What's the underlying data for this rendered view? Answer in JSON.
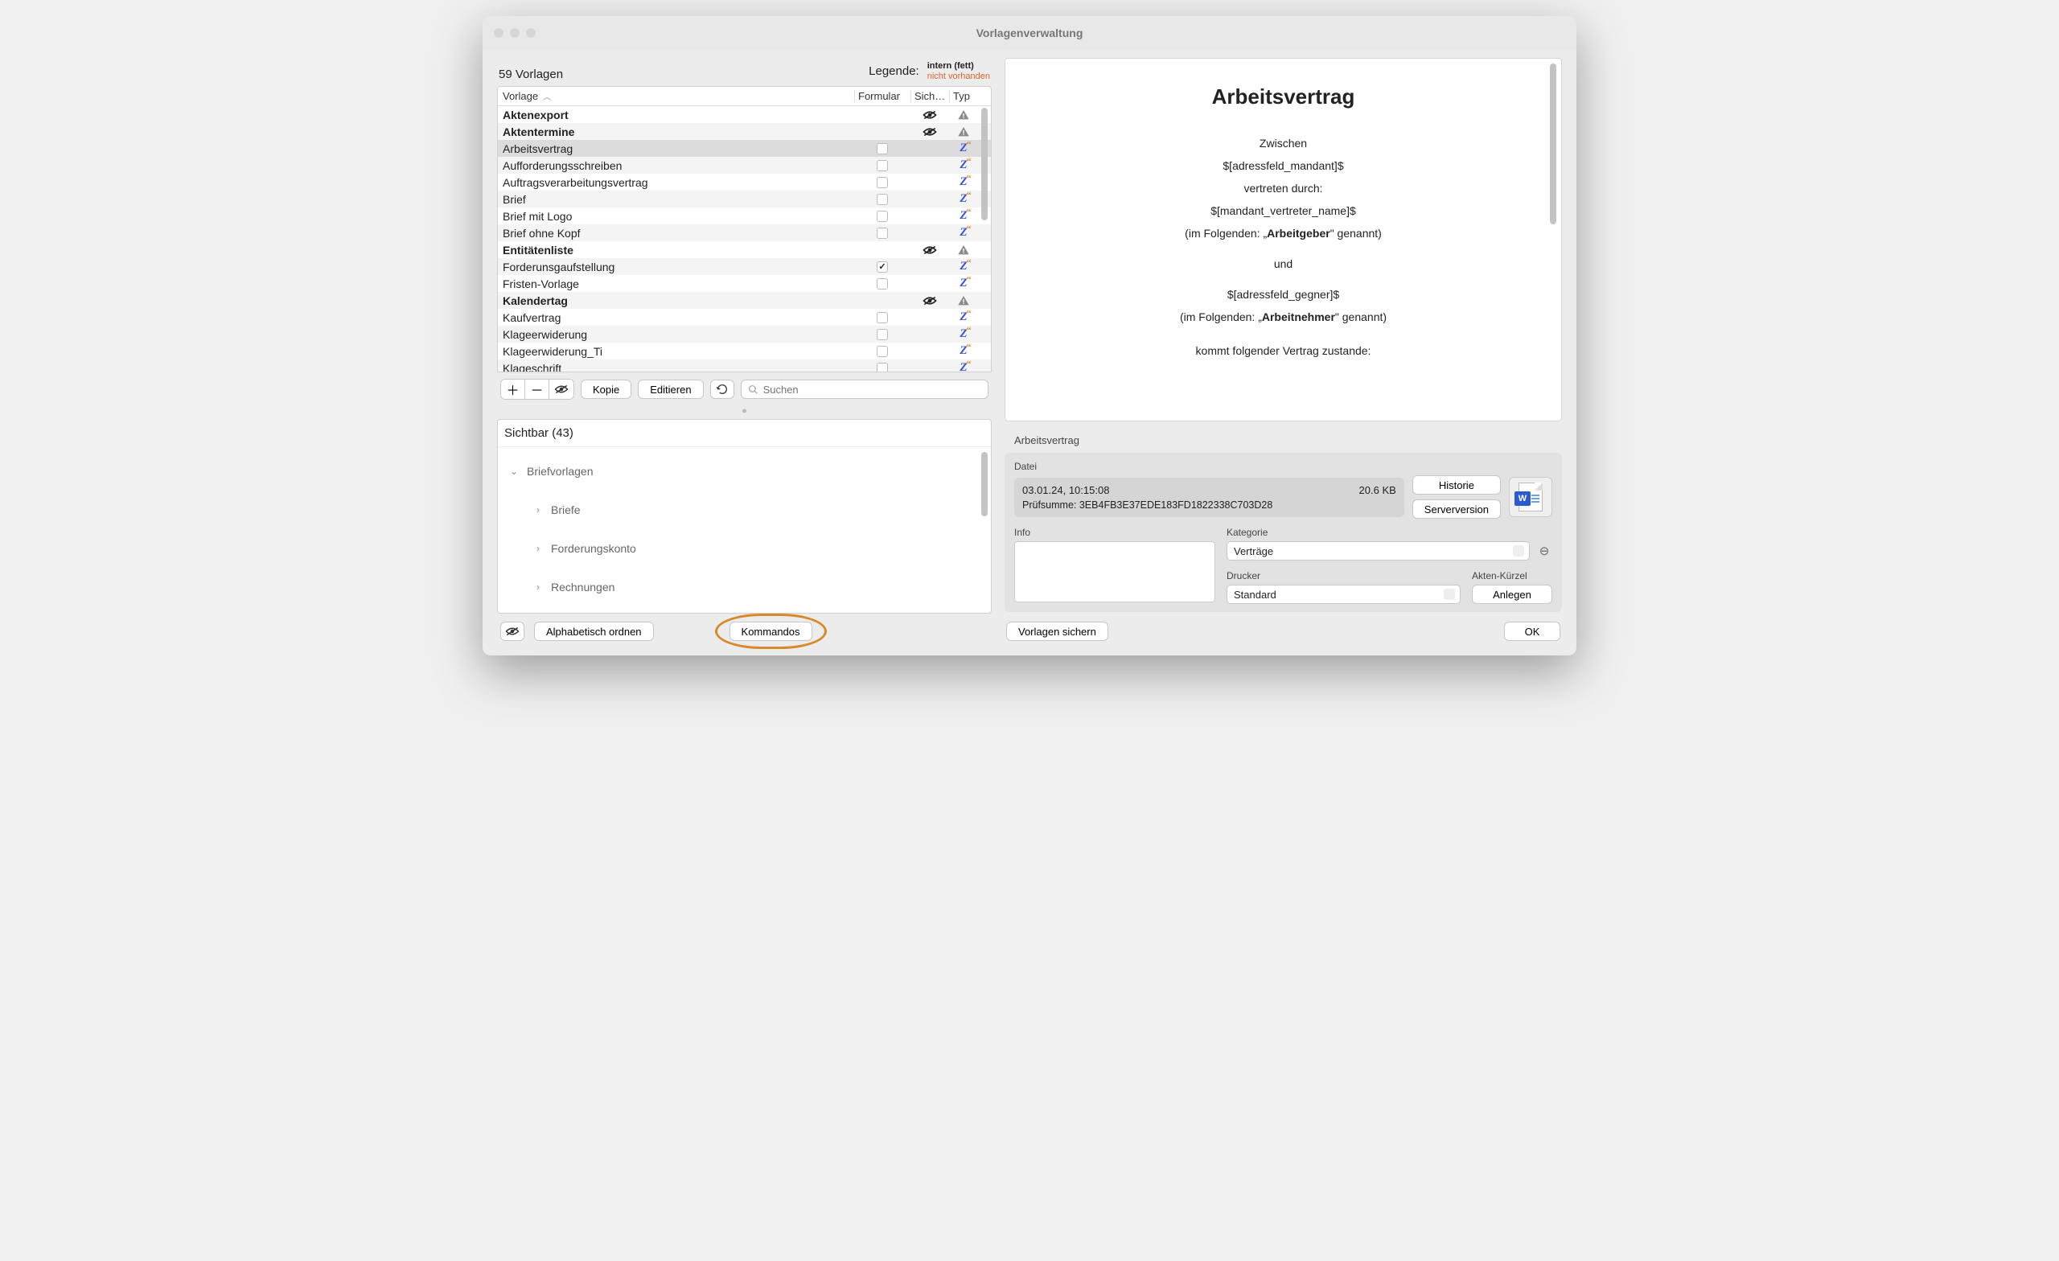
{
  "window": {
    "title": "Vorlagenverwaltung"
  },
  "counts": {
    "label": "59 Vorlagen",
    "legend_label": "Legende:",
    "legend_intern": "intern (fett)",
    "legend_missing": "nicht vorhanden"
  },
  "columns": {
    "vorlage": "Vorlage",
    "formular": "Formular",
    "sich": "Sich…",
    "typ": "Typ"
  },
  "rows": [
    {
      "name": "Aktenexport",
      "bold": true,
      "form": null,
      "hidden": true,
      "typ": "warn"
    },
    {
      "name": "Aktentermine",
      "bold": true,
      "form": null,
      "hidden": true,
      "typ": "warn"
    },
    {
      "name": "Arbeitsvertrag",
      "bold": false,
      "form": false,
      "hidden": false,
      "typ": "z",
      "selected": true
    },
    {
      "name": "Aufforderungsschreiben",
      "bold": false,
      "form": false,
      "hidden": false,
      "typ": "z"
    },
    {
      "name": "Auftragsverarbeitungsvertrag",
      "bold": false,
      "form": false,
      "hidden": false,
      "typ": "z"
    },
    {
      "name": "Brief",
      "bold": false,
      "form": false,
      "hidden": false,
      "typ": "z"
    },
    {
      "name": "Brief mit Logo",
      "bold": false,
      "form": false,
      "hidden": false,
      "typ": "z"
    },
    {
      "name": "Brief ohne Kopf",
      "bold": false,
      "form": false,
      "hidden": false,
      "typ": "z"
    },
    {
      "name": "Entitätenliste",
      "bold": true,
      "form": null,
      "hidden": true,
      "typ": "warn"
    },
    {
      "name": "Forderunsgaufstellung",
      "bold": false,
      "form": true,
      "hidden": false,
      "typ": "z"
    },
    {
      "name": "Fristen-Vorlage",
      "bold": false,
      "form": false,
      "hidden": false,
      "typ": "z"
    },
    {
      "name": "Kalendertag",
      "bold": true,
      "form": null,
      "hidden": true,
      "typ": "warn"
    },
    {
      "name": "Kaufvertrag",
      "bold": false,
      "form": false,
      "hidden": false,
      "typ": "z"
    },
    {
      "name": "Klageerwiderung",
      "bold": false,
      "form": false,
      "hidden": false,
      "typ": "z"
    },
    {
      "name": "Klageerwiderung_Ti",
      "bold": false,
      "form": false,
      "hidden": false,
      "typ": "z"
    },
    {
      "name": "Klageschrift",
      "bold": false,
      "form": false,
      "hidden": false,
      "typ": "z"
    }
  ],
  "toolbar": {
    "kopie": "Kopie",
    "editieren": "Editieren",
    "search_ph": "Suchen"
  },
  "visible": {
    "head": "Sichtbar (43)",
    "groups": [
      {
        "label": "Briefvorlagen",
        "open": true
      },
      {
        "label": "Briefe",
        "sub": true
      },
      {
        "label": "Forderungskonto",
        "sub": true
      },
      {
        "label": "Rechnungen",
        "sub": true
      }
    ]
  },
  "bottom": {
    "alpha": "Alphabetisch ordnen",
    "kommandos": "Kommandos"
  },
  "preview": {
    "title": "Arbeitsvertrag",
    "l1": "Zwischen",
    "l2": "$[adressfeld_mandant]$",
    "l3": "vertreten durch:",
    "l4": "$[mandant_vertreter_name]$",
    "l5a": "(im Folgenden: „",
    "l5b": "Arbeitgeber",
    "l5c": "\" genannt)",
    "l6": "und",
    "l7": "$[adressfeld_gegner]$",
    "l8a": "(im Folgenden: „",
    "l8b": "Arbeitnehmer",
    "l8c": "\" genannt)",
    "l9": "kommt folgender Vertrag zustande:"
  },
  "detail": {
    "name": "Arbeitsvertrag",
    "datei_label": "Datei",
    "date": "03.01.24, 10:15:08",
    "size": "20.6 KB",
    "hash_label": "Prüfsumme: ",
    "hash": "3EB4FB3E37EDE183FD1822338C703D28",
    "historie": "Historie",
    "serverversion": "Serverversion",
    "info_label": "Info",
    "kategorie_label": "Kategorie",
    "kategorie_value": "Verträge",
    "drucker_label": "Drucker",
    "drucker_value": "Standard",
    "akten_label": "Akten-Kürzel",
    "anlegen": "Anlegen"
  },
  "final": {
    "sichern": "Vorlagen sichern",
    "ok": "OK"
  }
}
